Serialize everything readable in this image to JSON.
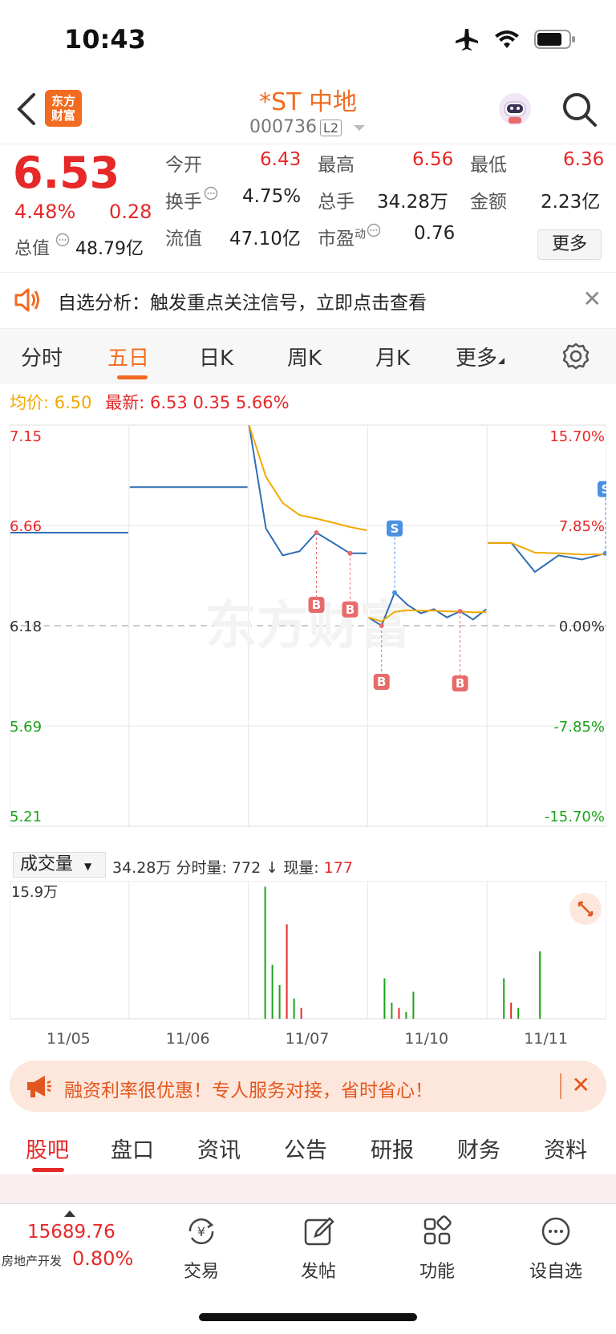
{
  "status": {
    "time": "10:43"
  },
  "header": {
    "name": "*ST 中地",
    "code": "000736",
    "l2": "L2",
    "logo_line1": "东方",
    "logo_line2": "财富"
  },
  "quote": {
    "price": "6.53",
    "pct": "4.48%",
    "chg": "0.28",
    "total_val_label": "总值",
    "total_val": "48.79亿",
    "open_label": "今开",
    "open": "6.43",
    "high_label": "最高",
    "high": "6.56",
    "low_label": "最低",
    "low": "6.36",
    "turnover_label": "换手",
    "turnover": "4.75%",
    "vol_label": "总手",
    "vol": "34.28万",
    "amount_label": "金额",
    "amount": "2.23亿",
    "float_label": "流值",
    "float": "47.10亿",
    "pe_label": "市盈",
    "pe_sup": "动",
    "pe": "0.76",
    "more": "更多"
  },
  "notice": {
    "text": "自选分析：触发重点关注信号，立即点击查看"
  },
  "tabs": [
    "分时",
    "五日",
    "日K",
    "周K",
    "月K",
    "更多"
  ],
  "legend": {
    "avg_label": "均价:",
    "avg": "6.50",
    "last_label": "最新:",
    "last": "6.53",
    "chg": "0.35",
    "pct": "5.66%"
  },
  "chart_data": {
    "type": "line",
    "y_left_ticks": [
      "7.15",
      "6.66",
      "6.18",
      "5.69",
      "5.21"
    ],
    "y_right_ticks": [
      "15.70%",
      "7.85%",
      "0.00%",
      "-7.85%",
      "-15.70%"
    ],
    "ylim": [
      5.21,
      7.15
    ],
    "x_labels": [
      "11/05",
      "11/06",
      "11/07",
      "11/10",
      "11/11"
    ],
    "watermark": "东方财富",
    "series": [
      {
        "values": [
          6.63,
          6.63,
          6.85,
          6.85,
          7.15,
          6.65,
          6.52,
          6.54,
          6.63,
          6.58,
          6.53,
          6.53,
          6.22,
          6.18,
          6.34,
          6.28,
          6.24,
          6.26,
          6.22,
          6.25,
          6.21,
          6.26,
          6.58,
          6.58,
          6.44,
          6.52,
          6.5,
          6.53
        ]
      }
    ],
    "signals": [
      "B",
      "B",
      "S",
      "B",
      "B",
      "S"
    ]
  },
  "volume": {
    "select": "成交量",
    "total": "34.28万",
    "detail_label": "分时量:",
    "detail": "772",
    "arrow": "↓",
    "now_label": "现量:",
    "now": "177",
    "max_label": "15.9万"
  },
  "promo": {
    "text": "融资利率很优惠！专人服务对接，省时省心！"
  },
  "bottom_tabs": [
    "股吧",
    "盘口",
    "资讯",
    "公告",
    "研报",
    "财务",
    "资料"
  ],
  "dock": {
    "index_val": "15689.76",
    "index_label": "房地产开发",
    "index_pct": "0.80%",
    "items": [
      "交易",
      "发帖",
      "功能",
      "设自选"
    ]
  }
}
